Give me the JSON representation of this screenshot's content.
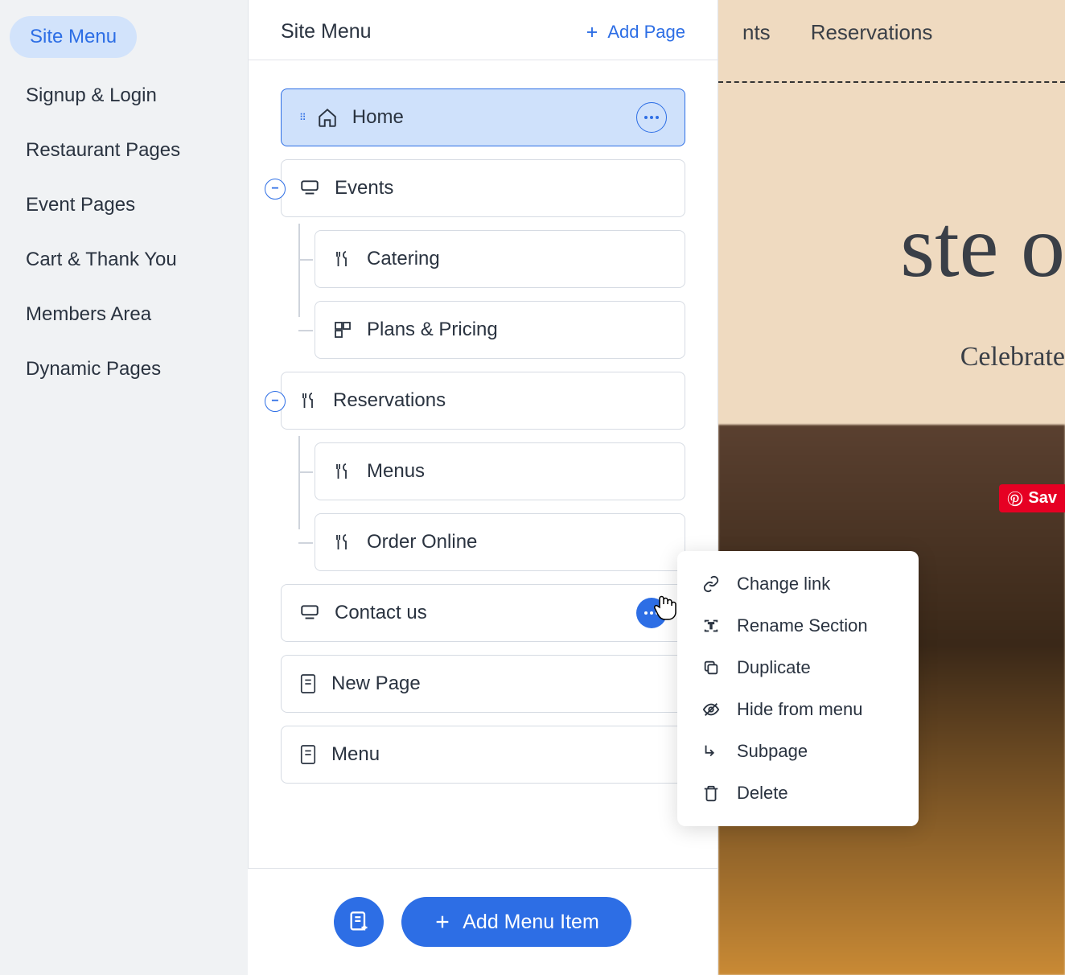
{
  "leftSidebar": {
    "items": [
      {
        "label": "Site Menu",
        "active": true
      },
      {
        "label": "Signup & Login",
        "active": false
      },
      {
        "label": "Restaurant Pages",
        "active": false
      },
      {
        "label": "Event Pages",
        "active": false
      },
      {
        "label": "Cart & Thank You",
        "active": false
      },
      {
        "label": "Members Area",
        "active": false
      },
      {
        "label": "Dynamic Pages",
        "active": false
      }
    ]
  },
  "panel": {
    "title": "Site Menu",
    "addPage": "Add Page",
    "pages": {
      "home": "Home",
      "events": "Events",
      "catering": "Catering",
      "plansPricing": "Plans & Pricing",
      "reservations": "Reservations",
      "menus": "Menus",
      "orderOnline": "Order Online",
      "contactUs": "Contact us",
      "newPage": "New Page",
      "menu": "Menu"
    },
    "addMenuItem": "Add Menu Item"
  },
  "canvas": {
    "navItems": [
      "nts",
      "Reservations"
    ],
    "heroTitle": "ste o",
    "heroSub": "Celebrate",
    "saveBadge": "Sav"
  },
  "contextMenu": {
    "items": [
      {
        "label": "Change link",
        "icon": "link"
      },
      {
        "label": "Rename Section",
        "icon": "rename"
      },
      {
        "label": "Duplicate",
        "icon": "duplicate"
      },
      {
        "label": "Hide from menu",
        "icon": "hide"
      },
      {
        "label": "Subpage",
        "icon": "subpage"
      },
      {
        "label": "Delete",
        "icon": "delete"
      }
    ]
  }
}
